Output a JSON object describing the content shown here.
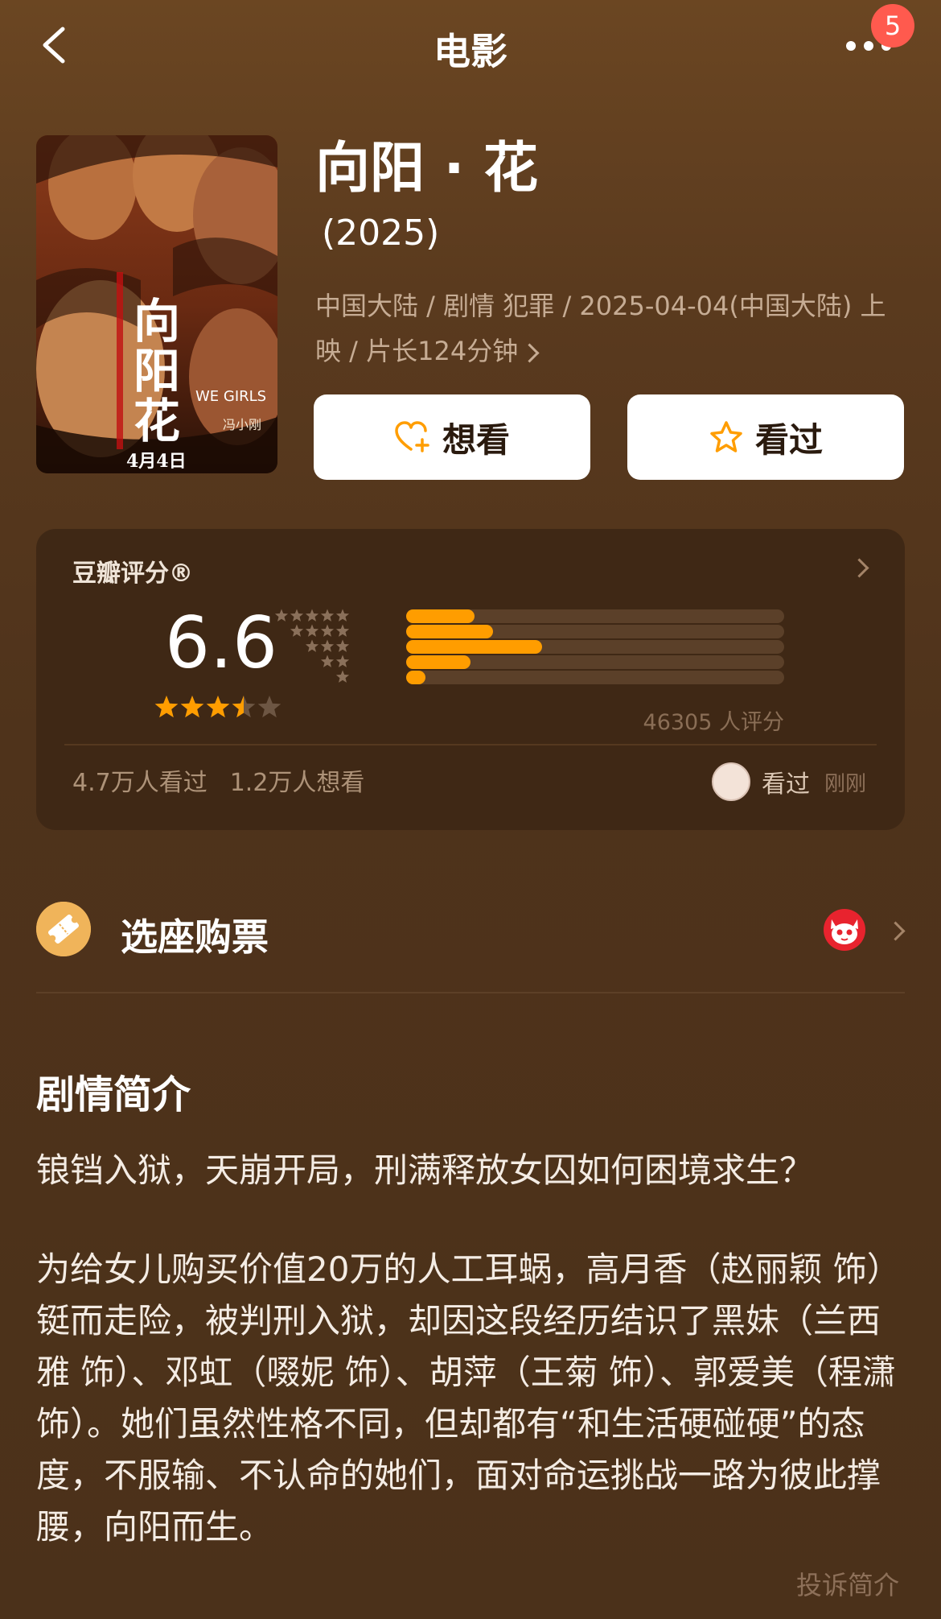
{
  "header": {
    "title": "电影",
    "notification_count": "5"
  },
  "movie": {
    "title": "向阳 · 花",
    "year": "(2025)",
    "meta": "中国大陆 / 剧情 犯罪 / 2025-04-04(中国大陆) 上映 / 片长124分钟",
    "poster": {
      "calligraphy": "向阳花",
      "english": "WE GIRLS",
      "director_credit": "冯小刚",
      "release": "4月4日"
    }
  },
  "actions": {
    "want_label": "想看",
    "seen_label": "看过"
  },
  "rating": {
    "title": "豆瓣评分®",
    "score": "6.6",
    "star_score": 3.5,
    "distribution": [
      {
        "stars": 5,
        "percent": 18
      },
      {
        "stars": 4,
        "percent": 23
      },
      {
        "stars": 3,
        "percent": 36
      },
      {
        "stars": 2,
        "percent": 17
      },
      {
        "stars": 1,
        "percent": 5
      }
    ],
    "count_text": "46305 人评分",
    "watched_text": "4.7万人看过",
    "want_text": "1.2万人想看",
    "my_status": "看过",
    "my_time": "刚刚"
  },
  "tickets": {
    "label": "选座购票"
  },
  "synopsis": {
    "title": "剧情简介",
    "tagline": "锒铛入狱，天崩开局，刑满释放女囚如何困境求生？",
    "body": "为给女儿购买价值20万的人工耳蜗，高月香（赵丽颖 饰）铤而走险，被判刑入狱，却因这段经历结识了黑妹（兰西雅 饰）、邓虹（啜妮 饰）、胡萍（王菊 饰）、郭爱美（程潇 饰）。她们虽然性格不同，但却都有“和生活硬碰硬”的态度，不服输、不认命的她们，面对命运挑战一路为彼此撑腰，向阳而生。",
    "report_label": "投诉简介"
  },
  "colors": {
    "accent": "#ff9d00",
    "badge": "#ff5a4e",
    "card_bg": "#3f2815"
  }
}
